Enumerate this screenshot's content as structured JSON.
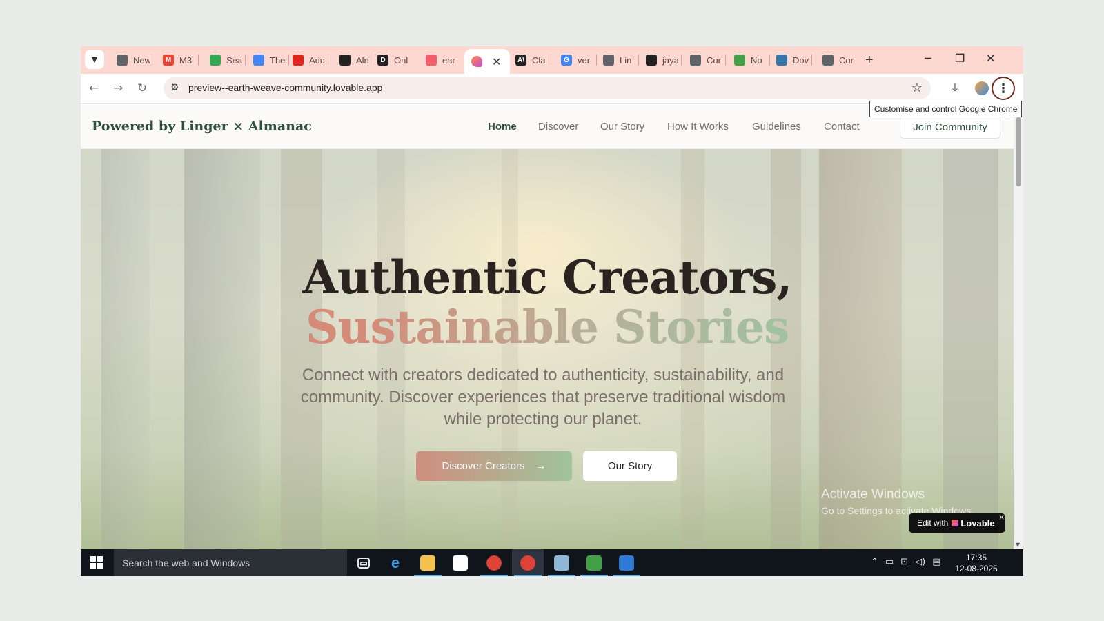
{
  "browser": {
    "tabs": [
      {
        "label": "New",
        "icon": "chrome-icon",
        "fav": "",
        "color": "#5f6368"
      },
      {
        "label": "M3",
        "icon": "gmail-icon",
        "fav": "M",
        "color": "#ea4335"
      },
      {
        "label": "Sea",
        "icon": "google-drive-icon",
        "fav": "",
        "color": "#34a853"
      },
      {
        "label": "The",
        "icon": "google-docs-icon",
        "fav": "",
        "color": "#4285f4"
      },
      {
        "label": "Adc",
        "icon": "adobe-icon",
        "fav": "",
        "color": "#e1251b"
      },
      {
        "label": "Aln",
        "icon": "openai-icon",
        "fav": "",
        "color": "#222222"
      },
      {
        "label": "Onl",
        "icon": "d-icon",
        "fav": "D",
        "color": "#222222"
      },
      {
        "label": "ear",
        "icon": "lovable-icon",
        "fav": "",
        "color": "#f25d6c"
      },
      {
        "label": "Cla",
        "icon": "anthropic-icon",
        "fav": "A\\",
        "color": "#222222"
      },
      {
        "label": "ver",
        "icon": "google-icon",
        "fav": "G",
        "color": "#4285f4"
      },
      {
        "label": "Lin",
        "icon": "globe-icon",
        "fav": "",
        "color": "#5f6368"
      },
      {
        "label": "jaya",
        "icon": "github-icon",
        "fav": "",
        "color": "#222222"
      },
      {
        "label": "Cor",
        "icon": "globe-icon",
        "fav": "",
        "color": "#5f6368"
      },
      {
        "label": "No",
        "icon": "nodejs-icon",
        "fav": "",
        "color": "#43a047"
      },
      {
        "label": "Dov",
        "icon": "python-icon",
        "fav": "",
        "color": "#3776ab"
      },
      {
        "label": "Cor",
        "icon": "globe-icon",
        "fav": "",
        "color": "#5f6368"
      }
    ],
    "active_tab": {
      "icon": "lovable-icon",
      "close": "✕"
    },
    "new_tab": "+",
    "url": "preview--earth-weave-community.lovable.app",
    "tooltip": "Customise and control Google Chrome",
    "accent": "#fcd8d0"
  },
  "site": {
    "brand": "Powered by Linger × Almanac",
    "nav": [
      "Home",
      "Discover",
      "Our Story",
      "How It Works",
      "Guidelines",
      "Contact"
    ],
    "join": "Join Community",
    "hero_line1": "Authentic Creators,",
    "hero_line2": "Sustainable Stories",
    "hero_sub": "Connect with creators dedicated to authenticity, sustainability, and community. Discover experiences that preserve traditional wisdom while protecting our planet.",
    "cta_primary": "Discover Creators",
    "cta_arrow": "→",
    "cta_secondary": "Our Story",
    "edit_prefix": "Edit with",
    "edit_brand": "Lovable",
    "edit_close": "×"
  },
  "watermark": {
    "title": "Activate Windows",
    "sub": "Go to Settings to activate Windows."
  },
  "taskbar": {
    "search_placeholder": "Search the web and Windows",
    "apps": [
      {
        "name": "task-view-icon",
        "glyph": "▭",
        "color": "#10151c",
        "run": false
      },
      {
        "name": "edge-icon",
        "glyph": "e",
        "color": "#1d7ad4",
        "run": false
      },
      {
        "name": "file-explorer-icon",
        "glyph": "",
        "color": "#f2c14e",
        "run": true
      },
      {
        "name": "store-icon",
        "glyph": "",
        "color": "#ffffff",
        "run": false
      },
      {
        "name": "chrome-icon",
        "glyph": "",
        "color": "#db4437",
        "run": true
      },
      {
        "name": "chrome-profile-icon",
        "glyph": "",
        "color": "#db4437",
        "run": true
      },
      {
        "name": "paint-icon",
        "glyph": "",
        "color": "#8fb8d8",
        "run": true
      },
      {
        "name": "nodejs-icon",
        "glyph": "",
        "color": "#43a047",
        "run": true
      },
      {
        "name": "remote-desktop-icon",
        "glyph": "",
        "color": "#2f7ad4",
        "run": true
      }
    ],
    "time": "17:35",
    "date": "12-08-2025"
  }
}
